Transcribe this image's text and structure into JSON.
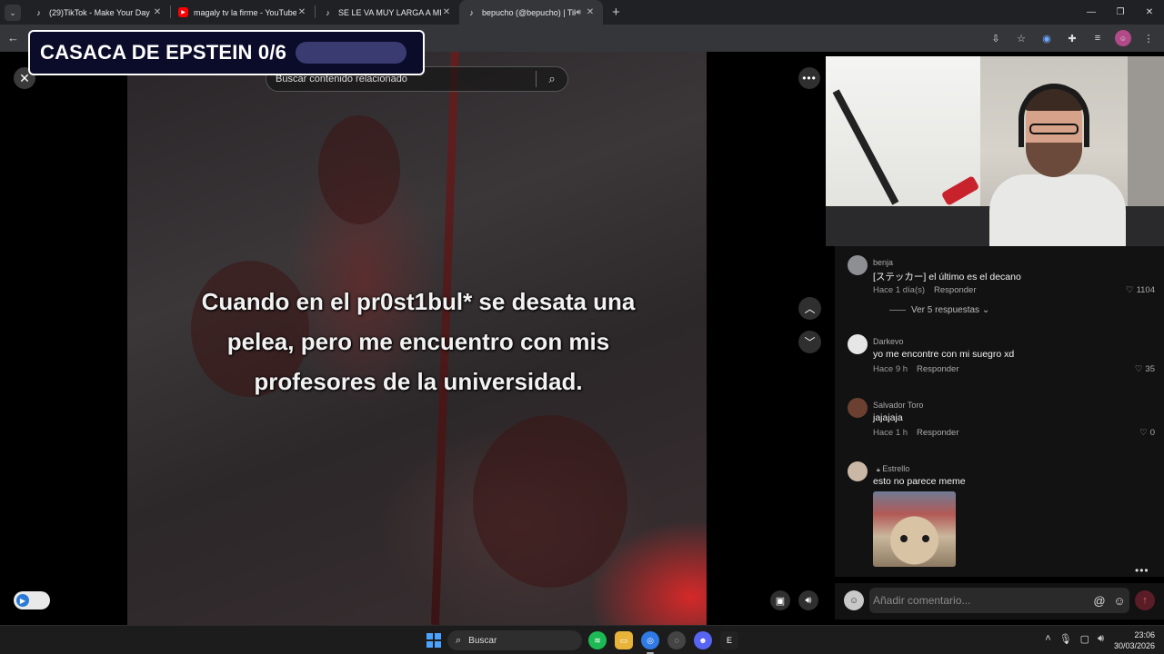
{
  "browser": {
    "tabs": [
      {
        "label": "(29)TikTok - Make Your Day",
        "icon": "tiktok-icon",
        "active": false
      },
      {
        "label": "magaly tv la firme - YouTube",
        "icon": "youtube-icon",
        "active": false
      },
      {
        "label": "SE LE VA MUY LARGA A MIKE A",
        "icon": "tiktok-icon",
        "active": false
      },
      {
        "label": "bepucho (@bepucho) | TikTok",
        "icon": "tiktok-icon",
        "active": true,
        "audio": true
      }
    ]
  },
  "overlay": {
    "title": "CASACA DE EPSTEIN 0/6",
    "progress": 0
  },
  "viewer": {
    "search_placeholder": "Buscar contenido relacionado",
    "caption_line1": "Cuando en el pr0st1bul* se desata una",
    "caption_line2": "pelea, pero me encuentro con mis",
    "caption_line3": "profesores de la universidad."
  },
  "comments": [
    {
      "author": "benja",
      "text": "[ステッカー] el último es el decano",
      "time": "Hace 1 día(s)",
      "reply": "Responder",
      "likes": "1104",
      "view_replies": "Ver 5 respuestas"
    },
    {
      "author": "Darkevo",
      "text": "yo me encontre con mi suegro xd",
      "time": "Hace 9 h",
      "reply": "Responder",
      "likes": "35"
    },
    {
      "author": "Salvador Toro",
      "text": "jajajaja",
      "time": "Hace 1 h",
      "reply": "Responder",
      "likes": "0"
    },
    {
      "author": "Estrello",
      "text": "esto no parece meme"
    }
  ],
  "composer": {
    "placeholder": "Añadir comentario..."
  },
  "taskbar": {
    "search_label": "Buscar",
    "time": "23:06",
    "date": "30/03/2026"
  }
}
